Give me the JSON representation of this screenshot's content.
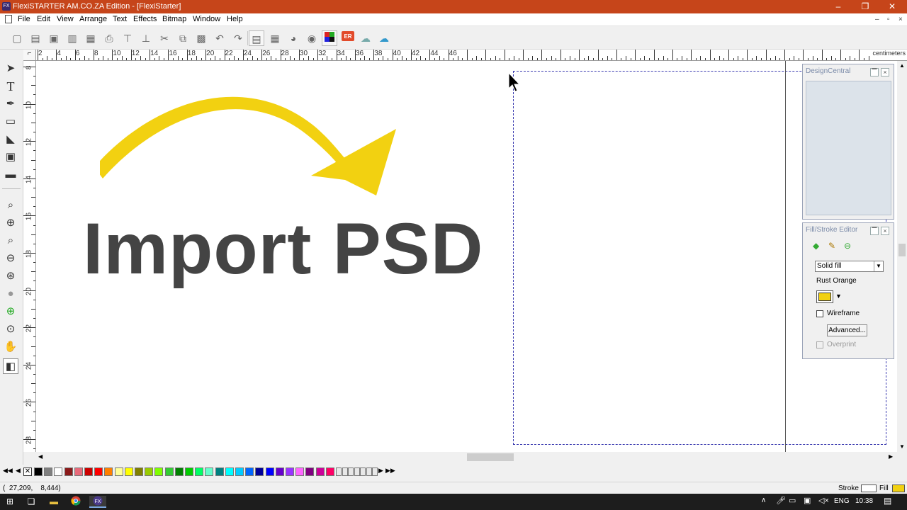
{
  "window": {
    "title": "FlexiSTARTER AM.CO.ZA Edition - [FlexiStarter]",
    "app_icon": "flexi-app-icon",
    "controls": [
      "–",
      "❐",
      "✕"
    ]
  },
  "menu": {
    "items": [
      "File",
      "Edit",
      "View",
      "Arrange",
      "Text",
      "Effects",
      "Bitmap",
      "Window",
      "Help"
    ]
  },
  "toolbar": {
    "icons": [
      "new-icon",
      "open-icon",
      "save-icon",
      "print-setup-icon",
      "production-icon",
      "print-icon",
      "output-icon",
      "send-icon",
      "cut-icon",
      "copy-icon",
      "paste-icon",
      "undo-icon",
      "redo-icon",
      "job-icon",
      "job-manager-icon",
      "color-icon",
      "color-match-icon",
      "swatch-icon",
      "er-icon",
      "cloud-icon",
      "cloud-upload-icon"
    ]
  },
  "ruler": {
    "units": "centimeters",
    "h_labels": [
      "2",
      "4",
      "6",
      "8",
      "10",
      "12",
      "14",
      "16",
      "18",
      "20",
      "22",
      "24",
      "26",
      "28",
      "30",
      "32",
      "34",
      "36",
      "38",
      "40",
      "42",
      "44",
      "46"
    ],
    "v_labels": [
      "8",
      "10",
      "12",
      "14",
      "16",
      "18",
      "20",
      "22",
      "24",
      "26",
      "28"
    ]
  },
  "canvas": {
    "text": "Import PSD",
    "text_color": "#444444",
    "arrow_color": "#f2d111"
  },
  "panels": {
    "design_central": {
      "title": "DesignCentral"
    },
    "fill_stroke": {
      "title": "Fill/Stroke Editor",
      "fill_type": "Solid fill",
      "color_name": "Rust Orange",
      "swatch_color": "#f2d111",
      "wireframe_label": "Wireframe",
      "advanced_label": "Advanced...",
      "overprint_label": "Overprint"
    }
  },
  "palette": {
    "colors": [
      "#000000",
      "#808080",
      "#ffffff",
      "#8b1a1a",
      "#e86a7a",
      "#cc0000",
      "#ff0000",
      "#ff8000",
      "#ffff99",
      "#ffff00",
      "#808000",
      "#99cc00",
      "#80ff00",
      "#33cc33",
      "#008000",
      "#00cc00",
      "#00ff66",
      "#66ffcc",
      "#008080",
      "#00ffff",
      "#00ccff",
      "#0066ff",
      "#000099",
      "#0000ff",
      "#6600cc",
      "#9933ff",
      "#ff66ff",
      "#800080",
      "#cc0099",
      "#ff0066"
    ]
  },
  "status": {
    "coords": "(  27,209,    8,444)",
    "stroke_label": "Stroke",
    "fill_label": "Fill",
    "fill_color": "#f2d111"
  },
  "taskbar": {
    "lang": "ENG",
    "time": "10:38"
  }
}
